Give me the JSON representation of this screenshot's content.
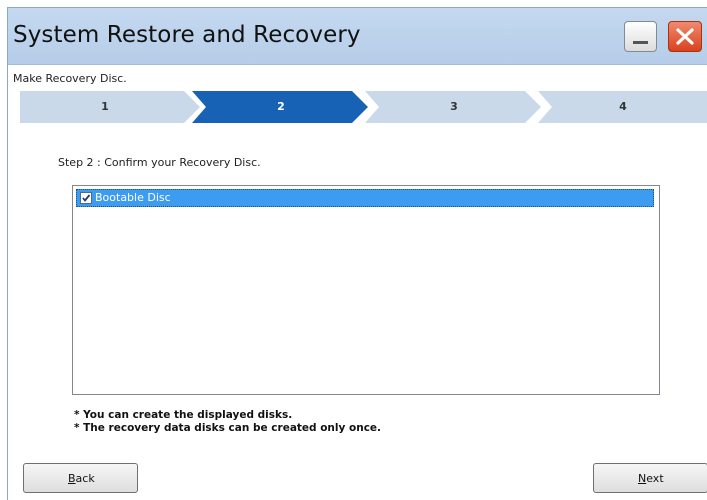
{
  "window": {
    "title": "System Restore and Recovery",
    "subtitle": "Make Recovery Disc."
  },
  "titlebar_buttons": {
    "minimize_icon": "minimize-icon",
    "close_icon": "close-icon"
  },
  "steps": [
    {
      "label": "1",
      "active": false
    },
    {
      "label": "2",
      "active": true
    },
    {
      "label": "3",
      "active": false
    },
    {
      "label": "4",
      "active": false
    }
  ],
  "content": {
    "step_heading": "Step 2 : Confirm your Recovery Disc.",
    "disc_list": [
      {
        "label": "Bootable Disc",
        "checked": true,
        "selected": true
      }
    ],
    "notes": [
      "* You can create the displayed disks.",
      "* The recovery data disks can be created only once."
    ]
  },
  "buttons": {
    "back": {
      "mnemonic": "B",
      "rest": "ack"
    },
    "next": {
      "mnemonic": "N",
      "rest": "ext"
    }
  },
  "colors": {
    "step_active": "#1762b5",
    "step_inactive": "#c9d9ea",
    "titlebar": "#bcd3ec",
    "selection": "#3d9cf0",
    "close_button": "#e0532e"
  }
}
